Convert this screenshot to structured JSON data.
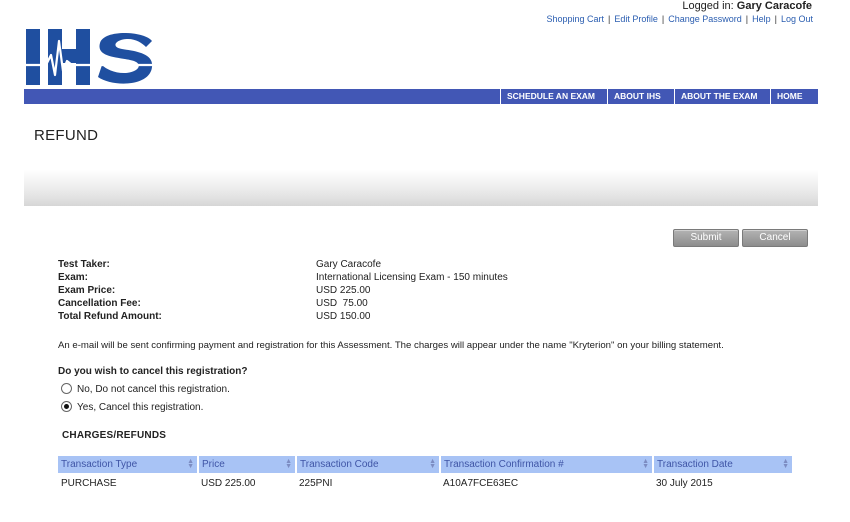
{
  "header": {
    "logged_in_label": "Logged in:",
    "user_name": "Gary Caracofe",
    "links": [
      "Shopping Cart",
      "Edit Profile",
      "Change Password",
      "Help",
      "Log Out"
    ],
    "logo_text": "IHS",
    "brand_color": "#1f4fa0"
  },
  "nav": {
    "items": [
      "SCHEDULE AN EXAM",
      "ABOUT IHS",
      "ABOUT THE EXAM",
      "HOME"
    ],
    "bg_color": "#4257b5"
  },
  "page": {
    "title": "REFUND"
  },
  "buttons": {
    "submit": "Submit",
    "cancel": "Cancel"
  },
  "details": {
    "rows": [
      {
        "label": "Test Taker:",
        "value": "Gary Caracofe"
      },
      {
        "label": "Exam:",
        "value": "International Licensing Exam - 150 minutes"
      },
      {
        "label": "Exam Price:",
        "value": "USD 225.00"
      },
      {
        "label": "Cancellation Fee:",
        "value": "USD  75.00"
      },
      {
        "label": "Total Refund Amount:",
        "value": "USD 150.00"
      }
    ]
  },
  "notice": "An e-mail will be sent confirming payment and registration for this Assessment. The charges will appear under the name \"Kryterion\" on your billing statement.",
  "cancel_question": {
    "question": "Do you wish to cancel this registration?",
    "options": [
      {
        "label": "No, Do not cancel this registration.",
        "selected": false
      },
      {
        "label": "Yes, Cancel this registration.",
        "selected": true
      }
    ]
  },
  "charges": {
    "title": "CHARGES/REFUNDS",
    "header_color": "#a8c3f5",
    "columns": [
      "Transaction Type",
      "Price",
      "Transaction Code",
      "Transaction Confirmation #",
      "Transaction Date"
    ],
    "rows": [
      [
        "PURCHASE",
        "USD 225.00",
        "225PNI",
        "A10A7FCE63EC",
        "30 July 2015"
      ]
    ]
  }
}
